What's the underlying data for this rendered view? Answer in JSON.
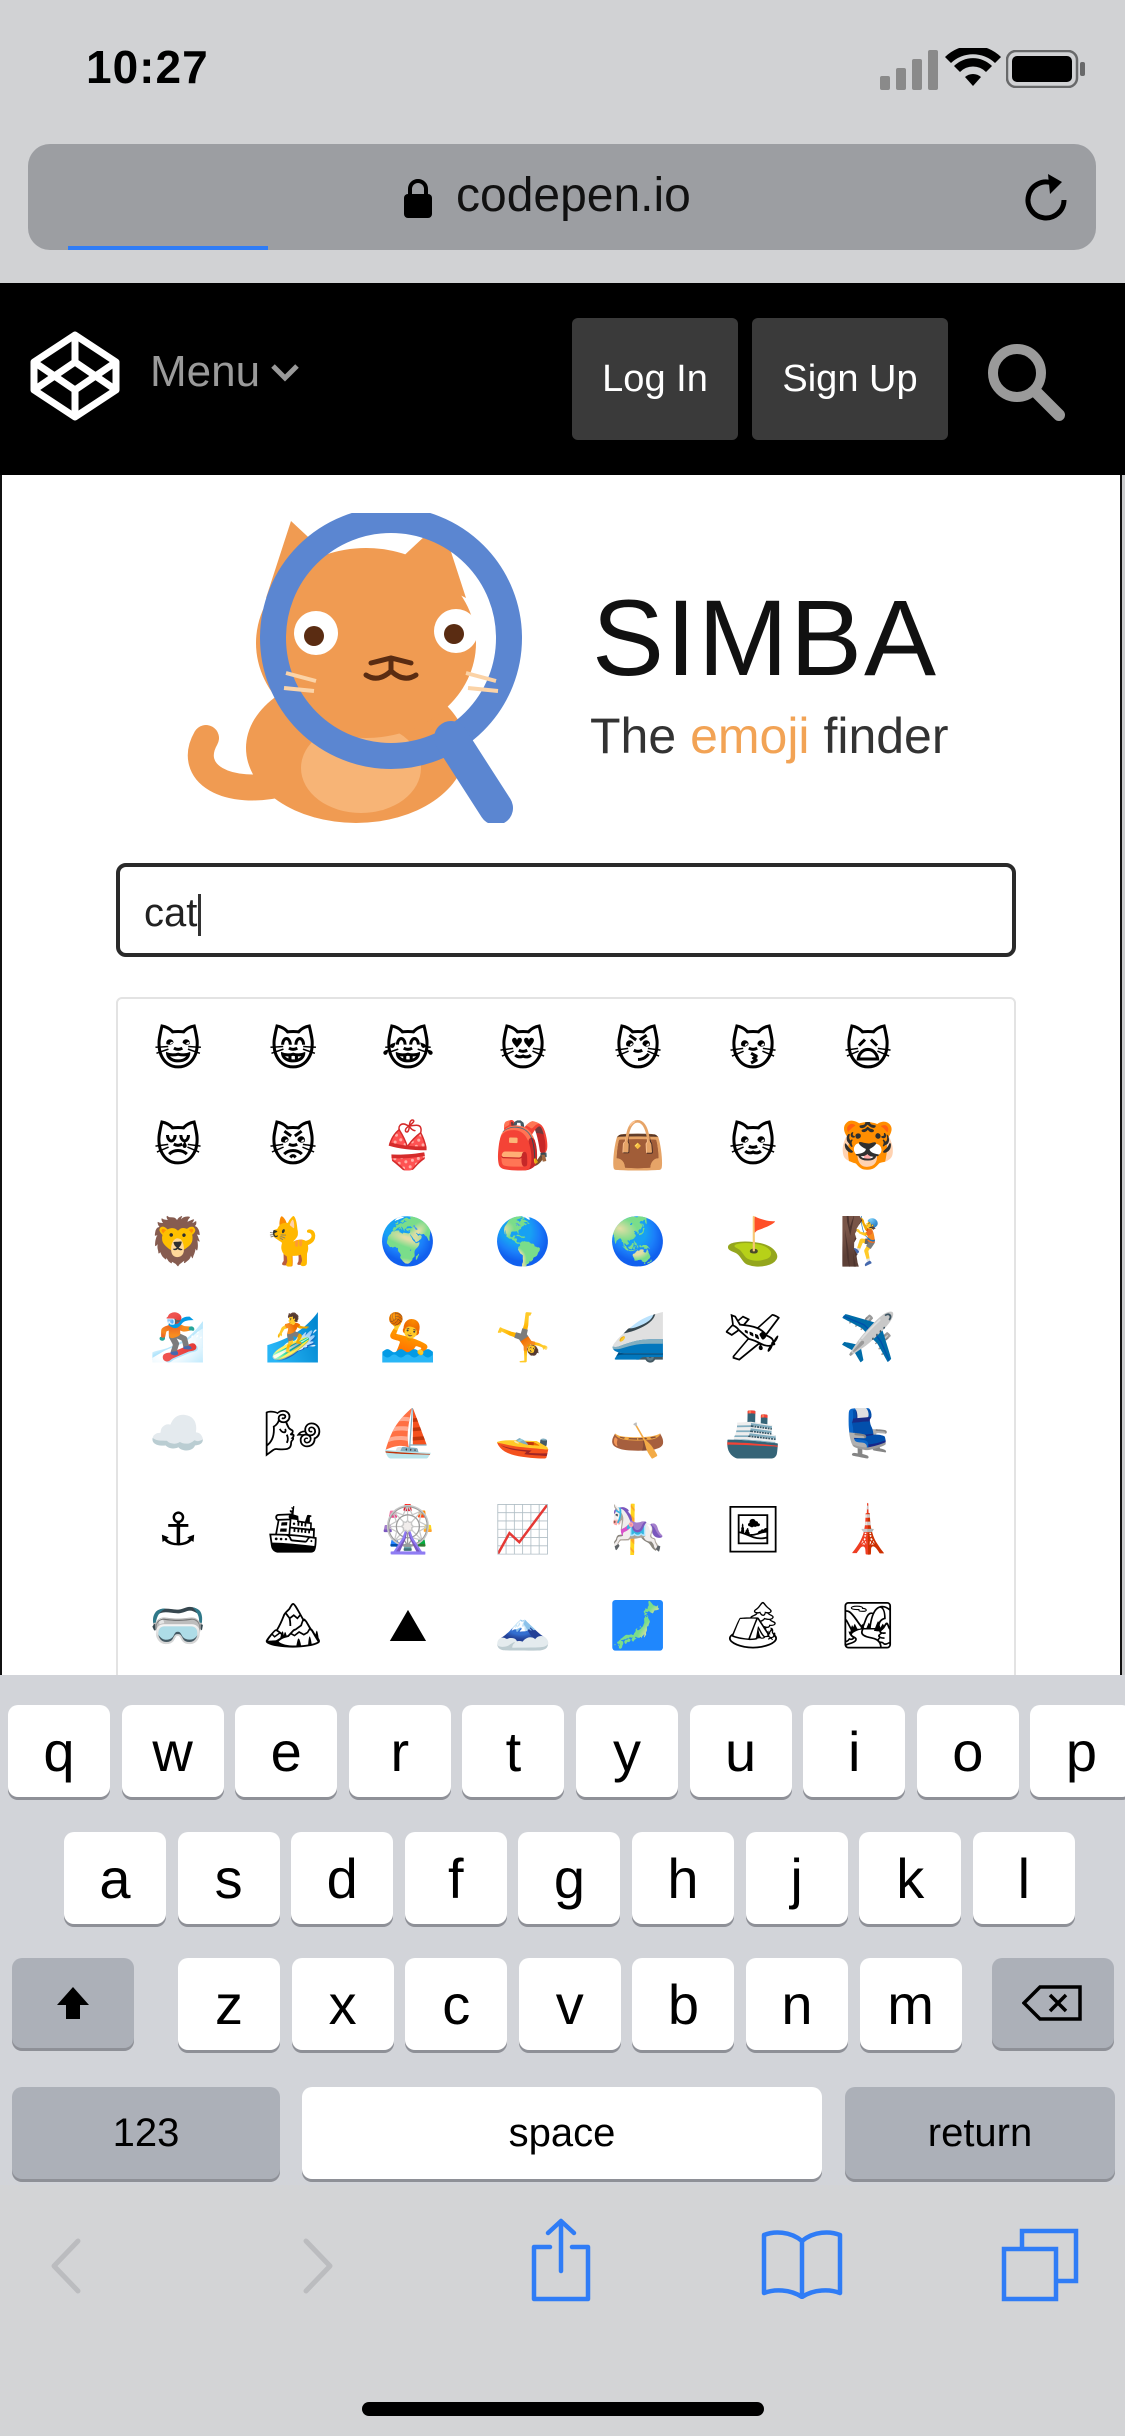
{
  "status_bar": {
    "time": "10:27"
  },
  "browser": {
    "url": "codepen.io"
  },
  "codepen_header": {
    "menu_label": "Menu",
    "login_label": "Log In",
    "signup_label": "Sign Up"
  },
  "app": {
    "title": "SIMBA",
    "tagline_prefix": "The ",
    "tagline_highlight": "emoji",
    "tagline_suffix": " finder",
    "search_value": "cat",
    "emoji_results": [
      [
        "😺",
        "😸",
        "😹",
        "😻",
        "😼",
        "😽",
        "🙀"
      ],
      [
        "😿",
        "😾",
        "👙",
        "🎒",
        "👜",
        "🐱",
        "🐯"
      ],
      [
        "🦁",
        "🐈",
        "🌍",
        "🌎",
        "🌏",
        "⛳",
        "🧗"
      ],
      [
        "🏂",
        "🏄",
        "🤽",
        "🤸",
        "🚄",
        "🛩",
        "✈️"
      ],
      [
        "☁️",
        "🌬",
        "⛵",
        "🚤",
        "🛶",
        "🚢",
        "💺"
      ],
      [
        "⚓",
        "🛳",
        "🎡",
        "📈",
        "🎠",
        "🖼",
        "🗼"
      ],
      [
        "🥽",
        "🏔",
        "⛰",
        "🗻",
        "🗾",
        "🏕",
        "🏞"
      ]
    ]
  },
  "keyboard": {
    "row1": [
      "q",
      "w",
      "e",
      "r",
      "t",
      "y",
      "u",
      "i",
      "o",
      "p"
    ],
    "row2": [
      "a",
      "s",
      "d",
      "f",
      "g",
      "h",
      "j",
      "k",
      "l"
    ],
    "row3": [
      "z",
      "x",
      "c",
      "v",
      "b",
      "n",
      "m"
    ],
    "numbers_label": "123",
    "space_label": "space",
    "return_label": "return"
  },
  "colors": {
    "accent": "#f2a355",
    "safari_blue": "#2f7cf6",
    "magnifier_blue": "#5b86d1",
    "cat_orange": "#f09b52"
  }
}
